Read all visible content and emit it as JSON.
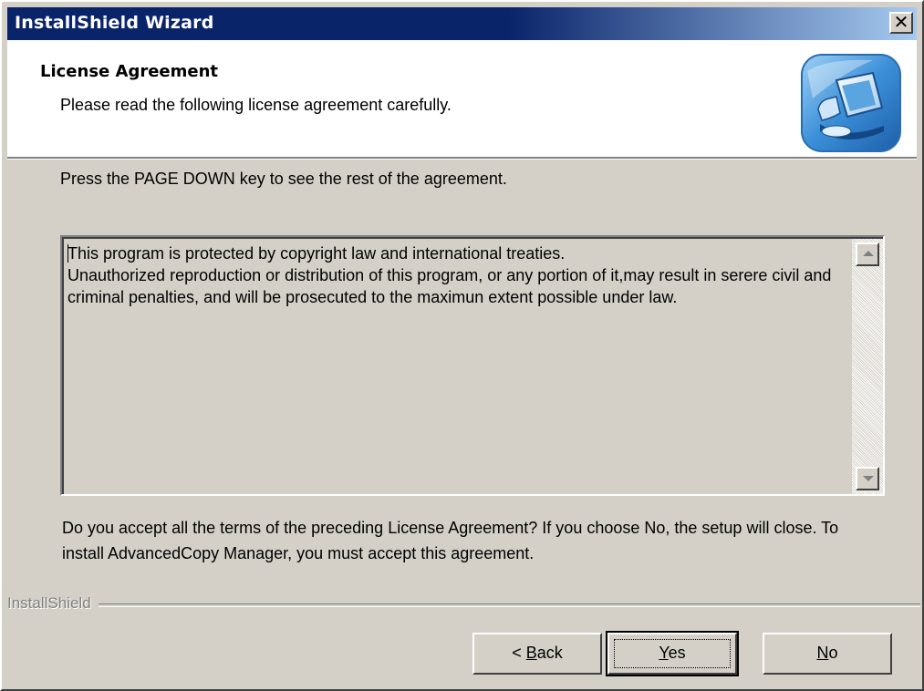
{
  "window": {
    "title": "InstallShield Wizard",
    "close_glyph": "✕"
  },
  "header": {
    "title": "License Agreement",
    "subtitle": "Please read the following license agreement carefully.",
    "icon": "computer-setup-icon"
  },
  "instruction": "Press the PAGE DOWN key to see the rest of the agreement.",
  "license": {
    "text": "This program is protected by copyright law and international treaties.\nUnauthorized reproduction or distribution of this program, or any portion of it,may result in serere civil and criminal penalties, and will be prosecuted to the maximun extent possible under law."
  },
  "question": "Do you accept all the terms of the preceding License Agreement?  If you choose No,  the setup will close.  To install AdvancedCopy Manager, you must accept this agreement.",
  "brand": "InstallShield",
  "buttons": {
    "back_prefix": "< ",
    "back_key": "B",
    "back_rest": "ack",
    "yes_key": "Y",
    "yes_rest": "es",
    "no_key": "N",
    "no_rest": "o"
  },
  "colors": {
    "titlebar_start": "#0a246a",
    "titlebar_end": "#a6caf0",
    "dialog_face": "#d4d0c8"
  }
}
